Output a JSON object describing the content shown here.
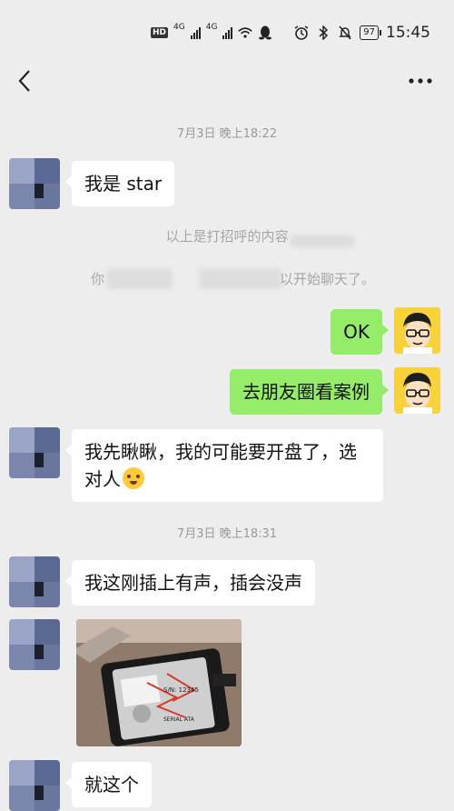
{
  "status_bar": {
    "hd": "HD",
    "net1": "4G",
    "net2": "4G",
    "battery": "97",
    "time": "15:45"
  },
  "nav": {
    "back_icon": "chevron-left-icon",
    "more_icon": "more-dots-icon"
  },
  "messages": {
    "time1": "7月3日 晚上18:22",
    "msg1": "我是 star",
    "sys1": "以上是打招呼的内容",
    "sys2_left": "你",
    "sys2_right": "以开始聊天了。",
    "msg2": "OK",
    "msg3": "去朋友圈看案例",
    "msg4": "我先瞅瞅，我的可能要开盘了，选对人",
    "time2": "7月3日 晚上18:31",
    "msg5": "我这刚插上有声，插会没声",
    "photo_label_1": "S/N: 12345",
    "photo_label_2": "SERIAL ATA",
    "msg6": "就这个"
  },
  "colors": {
    "background": "#ededed",
    "bubble_in": "#ffffff",
    "bubble_out": "#95ec69",
    "time_text": "#9a9a9a"
  }
}
